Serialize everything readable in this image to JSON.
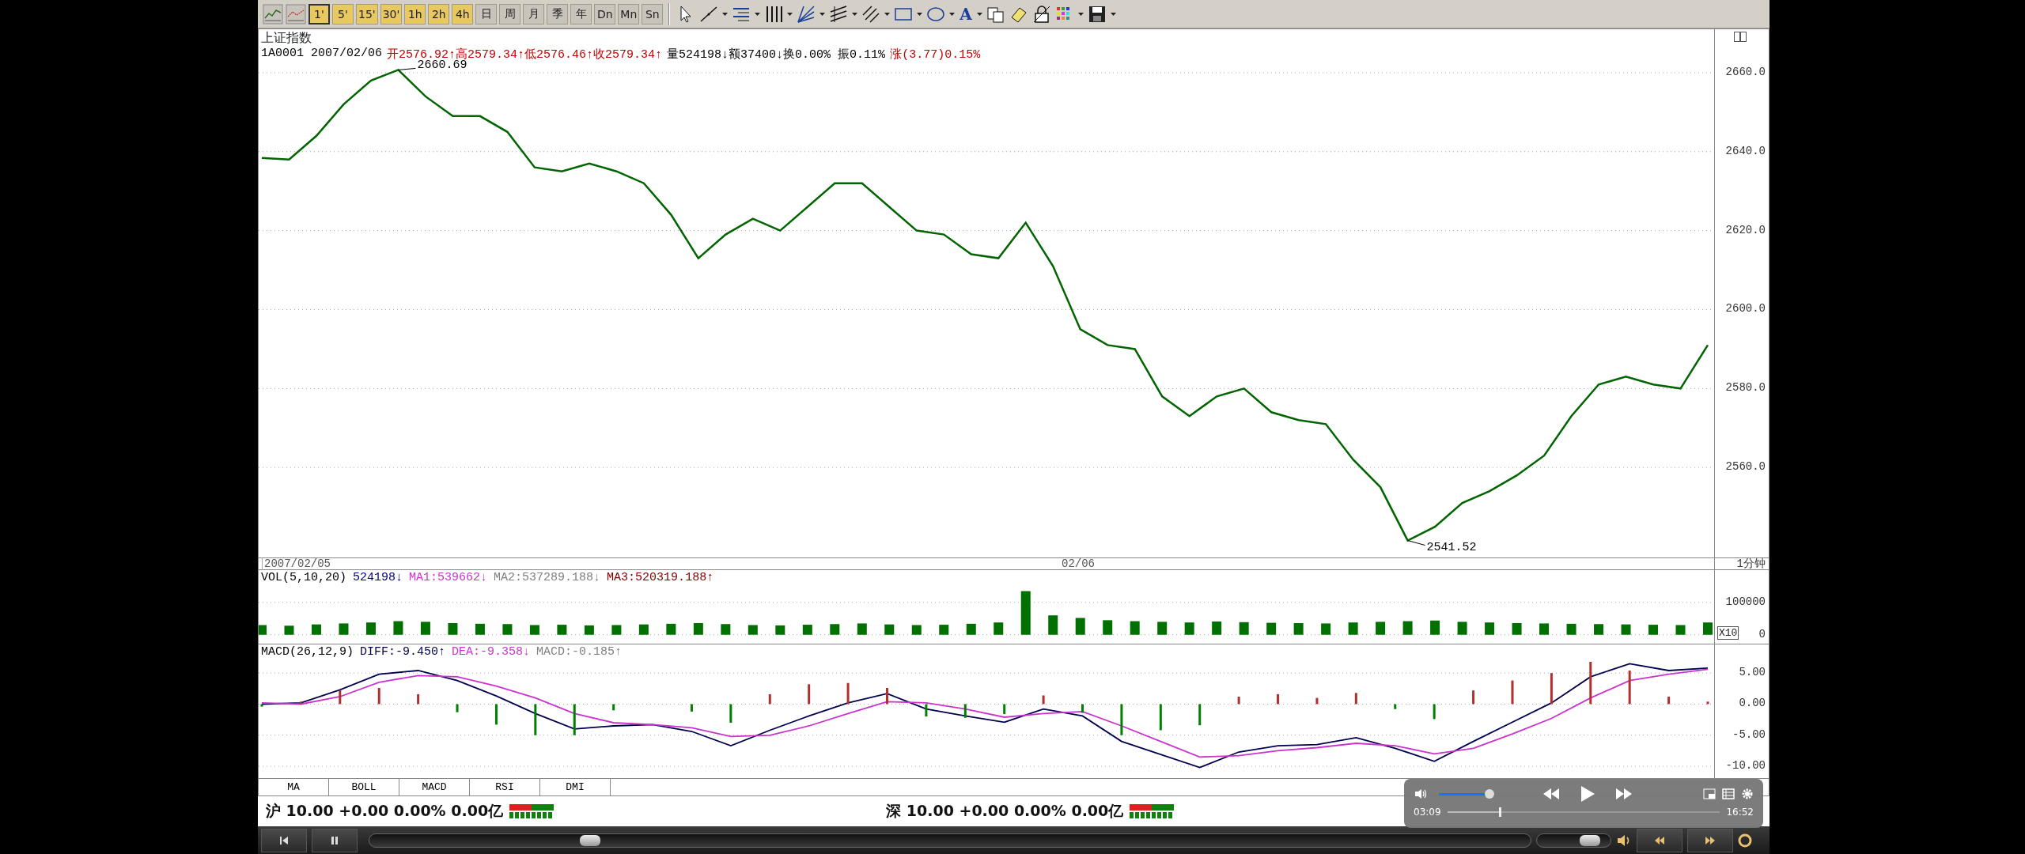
{
  "toolbar": {
    "period_buttons": [
      {
        "label": "1'",
        "kind": "intraday",
        "selected": true
      },
      {
        "label": "5'",
        "kind": "intraday",
        "selected": false
      },
      {
        "label": "15'",
        "kind": "intraday",
        "selected": false
      },
      {
        "label": "30'",
        "kind": "intraday",
        "selected": false
      },
      {
        "label": "1h",
        "kind": "intraday",
        "selected": false
      },
      {
        "label": "2h",
        "kind": "intraday",
        "selected": false
      },
      {
        "label": "4h",
        "kind": "intraday",
        "selected": false
      },
      {
        "label": "日",
        "kind": "period",
        "selected": false
      },
      {
        "label": "周",
        "kind": "period",
        "selected": false
      },
      {
        "label": "月",
        "kind": "period",
        "selected": false
      },
      {
        "label": "季",
        "kind": "period",
        "selected": false
      },
      {
        "label": "年",
        "kind": "period",
        "selected": false
      },
      {
        "label": "Dn",
        "kind": "period",
        "selected": false
      },
      {
        "label": "Mn",
        "kind": "period",
        "selected": false
      },
      {
        "label": "Sn",
        "kind": "period",
        "selected": false
      }
    ],
    "text_tool_label": "A"
  },
  "price_pane": {
    "title": "上证指数",
    "quote": [
      {
        "text": "1A0001 2007/02/06",
        "color": "#000000"
      },
      {
        "text": "开2576.92↑高2579.34↑低2576.46↑收2579.34↑",
        "color": "#c00000"
      },
      {
        "text": "量524198↓额37400↓换0.00% 振0.11%",
        "color": "#000000"
      },
      {
        "text": "涨(3.77)0.15%",
        "color": "#c00000"
      }
    ],
    "chart_data": {
      "type": "line",
      "grid": true,
      "ylim": [
        2537,
        2671
      ],
      "yticks": [
        {
          "value": 2560,
          "label": "2560.0"
        },
        {
          "value": 2580,
          "label": "2580.0"
        },
        {
          "value": 2600,
          "label": "2600.0"
        },
        {
          "value": 2620,
          "label": "2620.0"
        },
        {
          "value": 2640,
          "label": "2640.0"
        },
        {
          "value": 2660,
          "label": "2660.0"
        }
      ],
      "series": [
        {
          "color": "#006400",
          "values": [
            2638.4,
            2638,
            2644,
            2652,
            2658,
            2660.7,
            2654,
            2649,
            2649,
            2645,
            2636,
            2635,
            2637,
            2635,
            2632,
            2624,
            2613,
            2619,
            2623,
            2620,
            2626,
            2632,
            2632,
            2626,
            2620,
            2619,
            2614,
            2613,
            2622,
            2611,
            2595,
            2591,
            2590,
            2578,
            2573,
            2578,
            2580,
            2574,
            2572,
            2571,
            2562,
            2555,
            2541.5,
            2545,
            2551,
            2554,
            2558,
            2563,
            2573,
            2581,
            2583,
            2581,
            2580,
            2591
          ]
        }
      ],
      "annotations": [
        "2660.69",
        "2541.52"
      ]
    },
    "date_labels": [
      "2007/02/05",
      "02/06"
    ],
    "period_label": "1分钟"
  },
  "volume_pane": {
    "legend": [
      {
        "text": "VOL(5,10,20)",
        "color": "#000000"
      },
      {
        "text": "524198↓",
        "color": "#000080"
      },
      {
        "text": "MA1:539662↓",
        "color": "#cc33cc"
      },
      {
        "text": "MA2:537289.188↓",
        "color": "#808080"
      },
      {
        "text": "MA3:520319.188↑",
        "color": "#800000"
      }
    ],
    "scale_label": "X10",
    "chart_data": {
      "type": "bar",
      "grid": true,
      "ylim": [
        -30000,
        200000
      ],
      "yticks": [
        {
          "value": 0,
          "label": "0"
        },
        {
          "value": 100000,
          "label": "100000"
        }
      ],
      "series": [
        {
          "color": "#007000",
          "values": [
            30000,
            28000,
            32000,
            35000,
            38000,
            42000,
            40000,
            36000,
            34000,
            33000,
            30000,
            31000,
            29000,
            30000,
            32000,
            34000,
            36000,
            33000,
            30000,
            29000,
            31000,
            33000,
            35000,
            32000,
            30000,
            31000,
            34000,
            38000,
            135000,
            60000,
            52000,
            45000,
            42000,
            40000,
            38000,
            41000,
            39000,
            37000,
            36000,
            35000,
            38000,
            40000,
            42000,
            44000,
            40000,
            38000,
            36000,
            35000,
            34000,
            33000,
            32000,
            31000,
            30000,
            38000
          ]
        }
      ]
    }
  },
  "macd_pane": {
    "legend": [
      {
        "text": "MACD(26,12,9)",
        "color": "#000000"
      },
      {
        "text": "DIFF:-9.450↑",
        "color": "#000050"
      },
      {
        "text": "DEA:-9.358↓",
        "color": "#cc33cc"
      },
      {
        "text": "MACD:-0.185↑",
        "color": "#808080"
      }
    ],
    "chart_data": {
      "type": "line",
      "grid": true,
      "ylim": [
        -11.9,
        9.6
      ],
      "yticks": [
        {
          "value": 5,
          "label": "5.00"
        },
        {
          "value": 0,
          "label": "0.00"
        },
        {
          "value": -5,
          "label": "-5.00"
        },
        {
          "value": -10,
          "label": "-10.00"
        }
      ],
      "series": [
        {
          "color": "#000050",
          "values": [
            0,
            0.2,
            2.3,
            4.8,
            5.4,
            3.8,
            1.3,
            -1.5,
            -4,
            -3.5,
            -3.3,
            -4.4,
            -6.7,
            -4.2,
            -1.9,
            0.2,
            1.7,
            -0.8,
            -1.9,
            -2.9,
            -0.8,
            -1.9,
            -6,
            -8.1,
            -10.2,
            -7.7,
            -6.7,
            -6.5,
            -5.4,
            -7.1,
            -9.2,
            -6,
            -2.9,
            0.2,
            4.4,
            6.5,
            5.4,
            5.8
          ]
        },
        {
          "color": "#cc33cc",
          "values": [
            0.2,
            0,
            1.2,
            3.5,
            4.6,
            4.4,
            2.9,
            1.0,
            -1.5,
            -3,
            -3.3,
            -3.8,
            -5.2,
            -5,
            -3.5,
            -1.5,
            0.4,
            0.2,
            -0.8,
            -2.1,
            -1.5,
            -1.2,
            -3.5,
            -6,
            -8.5,
            -8.3,
            -7.5,
            -7,
            -6.3,
            -6.7,
            -8,
            -7.1,
            -4.8,
            -2.3,
            1,
            3.8,
            4.8,
            5.6
          ]
        },
        {
          "type": "bar",
          "color": "#b03030",
          "values": [
            null,
            0.4,
            2.2,
            2.6,
            1.6,
            null,
            null,
            null,
            null,
            null,
            null,
            null,
            null,
            1.6,
            3.2,
            3.4,
            2.6,
            null,
            null,
            null,
            1.4,
            null,
            null,
            null,
            null,
            1.2,
            1.6,
            1,
            1.8,
            null,
            null,
            2.2,
            3.8,
            5,
            6.8,
            5.4,
            1.2,
            0.4
          ]
        },
        {
          "type": "bar",
          "color": "#008000",
          "values": [
            -0.4,
            null,
            null,
            null,
            null,
            -1.3,
            -3.3,
            -5,
            -5,
            -1,
            null,
            -1.2,
            -3,
            null,
            null,
            null,
            null,
            -2,
            -2.2,
            -1.6,
            null,
            -1.4,
            -5,
            -4.2,
            -3.4,
            null,
            null,
            null,
            null,
            -0.8,
            -2.4,
            null,
            null,
            null,
            null,
            null,
            null,
            null
          ]
        }
      ]
    }
  },
  "indicator_tabs": [
    "MA",
    "BOLL",
    "MACD",
    "RSI",
    "DMI"
  ],
  "status_bar": [
    {
      "text": "沪 10.00 +0.00 0.00% 0.00亿"
    },
    {
      "text": "深 10.00 +0.00 0.00% 0.00亿"
    }
  ],
  "player_bar": {
    "seek": {
      "level": 0.19
    },
    "volume": {
      "level": 0.7
    }
  },
  "player_overlay": {
    "volume": {
      "level": 1.0
    },
    "elapsed": "03:09",
    "progress": {
      "level": 0.19
    },
    "duration": "16:52"
  }
}
